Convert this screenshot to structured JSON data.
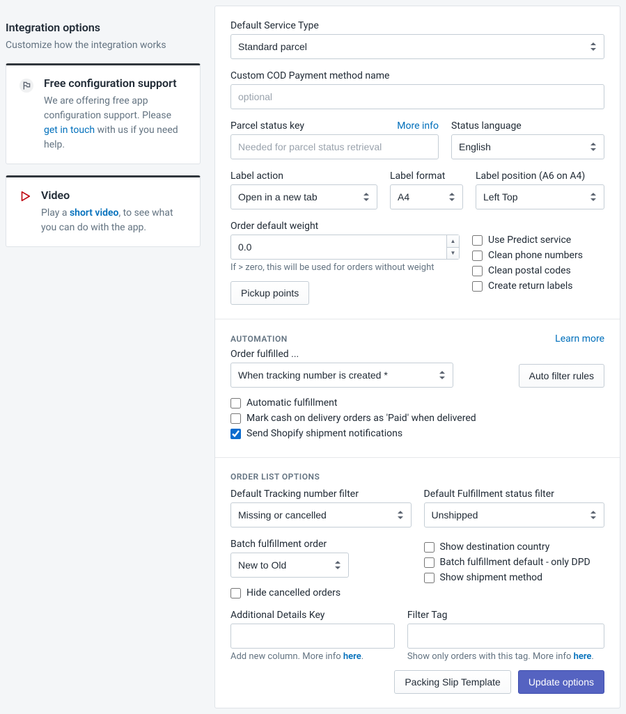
{
  "sidebar": {
    "title": "Integration options",
    "subtitle": "Customize how the integration works",
    "support": {
      "title": "Free configuration support",
      "body_pre": "We are offering free app configuration support. Please ",
      "link": "get in touch",
      "body_post": " with us if you need help."
    },
    "video": {
      "title": "Video",
      "body_pre": "Play a ",
      "link": "short video",
      "body_post": ", to see what you can do with the app."
    }
  },
  "svc": {
    "label": "Default Service Type",
    "value": "Standard parcel"
  },
  "cod": {
    "label": "Custom COD Payment method name",
    "placeholder": "optional"
  },
  "pkey": {
    "label": "Parcel status key",
    "more": "More info",
    "placeholder": "Needed for parcel status retrieval"
  },
  "lang": {
    "label": "Status language",
    "value": "English"
  },
  "lbl_action": {
    "label": "Label action",
    "value": "Open in a new tab"
  },
  "lbl_format": {
    "label": "Label format",
    "value": "A4"
  },
  "lbl_pos": {
    "label": "Label position (A6 on A4)",
    "value": "Left Top"
  },
  "weight": {
    "label": "Order default weight",
    "value": "0.0",
    "hint": "If > zero, this will be used for orders without weight"
  },
  "pickup_btn": "Pickup points",
  "checks1": {
    "predict": "Use Predict service",
    "phones": "Clean phone numbers",
    "postal": "Clean postal codes",
    "return": "Create return labels"
  },
  "auto": {
    "title": "Automation",
    "learn": "Learn more",
    "fulfilled_label": "Order fulfilled ...",
    "fulfilled_value": "When tracking number is created *",
    "rules_btn": "Auto filter rules",
    "c1": "Automatic fulfillment",
    "c2": "Mark cash on delivery orders as 'Paid' when delivered",
    "c3": "Send Shopify shipment notifications"
  },
  "list": {
    "title": "Order list options",
    "trk": {
      "label": "Default Tracking number filter",
      "value": "Missing or cancelled"
    },
    "ful": {
      "label": "Default Fulfillment status filter",
      "value": "Unshipped"
    },
    "batch": {
      "label": "Batch fulfillment order",
      "value": "New to Old"
    },
    "c_dest": "Show destination country",
    "c_dpd": "Batch fulfillment default - only DPD",
    "c_ship": "Show shipment method",
    "c_hide": "Hide cancelled orders",
    "detkey": {
      "label": "Additional Details Key",
      "hint_pre": "Add new column. More info ",
      "hint_link": "here",
      "hint_post": "."
    },
    "ftag": {
      "label": "Filter Tag",
      "hint_pre": "Show only orders with this tag. More info ",
      "hint_link": "here",
      "hint_post": "."
    }
  },
  "footer": {
    "slip": "Packing Slip Template",
    "update": "Update options"
  }
}
